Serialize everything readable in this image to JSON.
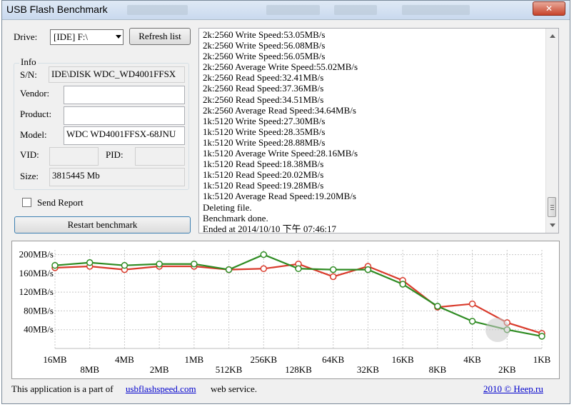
{
  "window": {
    "title": "USB Flash Benchmark",
    "close_glyph": "✕"
  },
  "drive": {
    "label": "Drive:",
    "selected": "[IDE] F:\\"
  },
  "refresh_label": "Refresh list",
  "info": {
    "group_label": "Info",
    "sn_label": "S/N:",
    "sn_value": "IDE\\DISK WDC_WD4001FFSX",
    "vendor_label": "Vendor:",
    "vendor_value": "",
    "product_label": "Product:",
    "product_value": "",
    "model_label": "Model:",
    "model_value": "WDC WD4001FFSX-68JNU",
    "vid_label": "VID:",
    "vid_value": "",
    "pid_label": "PID:",
    "pid_value": "",
    "size_label": "Size:",
    "size_value": "3815445 Mb"
  },
  "send_report_label": "Send Report",
  "restart_label": "Restart benchmark",
  "log_lines": [
    "2k:2560 Write Speed:53.05MB/s",
    "2k:2560 Write Speed:56.08MB/s",
    "2k:2560 Write Speed:56.05MB/s",
    "2k:2560 Average Write Speed:55.02MB/s",
    "2k:2560 Read Speed:32.41MB/s",
    "2k:2560 Read Speed:37.36MB/s",
    "2k:2560 Read Speed:34.51MB/s",
    "2k:2560 Average Read Speed:34.64MB/s",
    "1k:5120 Write Speed:27.30MB/s",
    "1k:5120 Write Speed:28.35MB/s",
    "1k:5120 Write Speed:28.88MB/s",
    "1k:5120 Average Write Speed:28.16MB/s",
    "1k:5120 Read Speed:18.38MB/s",
    "1k:5120 Read Speed:20.02MB/s",
    "1k:5120 Read Speed:19.28MB/s",
    "1k:5120 Average Read Speed:19.20MB/s",
    "Deleting file.",
    "Benchmark done.",
    "Ended at 2014/10/10 下午 07:46:17"
  ],
  "status": {
    "prefix": "This application is a part of",
    "link": "usbflashspeed.com",
    "suffix": "web service.",
    "credit": "2010 © Heep.ru"
  },
  "colors": {
    "write": "#d93a2b",
    "read": "#2e8b22"
  },
  "chart_data": {
    "type": "line",
    "x": [
      "16MB",
      "8MB",
      "4MB",
      "2MB",
      "1MB",
      "512KB",
      "256KB",
      "128KB",
      "64KB",
      "32KB",
      "16KB",
      "8KB",
      "4KB",
      "2KB",
      "1KB"
    ],
    "y_ticks": [
      "200MB/s",
      "160MB/s",
      "120MB/s",
      "80MB/s",
      "40MB/s"
    ],
    "y_tick_values": [
      200,
      160,
      120,
      80,
      40
    ],
    "ylim": [
      0,
      210
    ],
    "series": [
      {
        "values": [
          172,
          175,
          168,
          175,
          175,
          168,
          170,
          180,
          153,
          175,
          145,
          88,
          95,
          55,
          32
        ]
      },
      {
        "values": [
          177,
          183,
          177,
          180,
          180,
          168,
          200,
          170,
          168,
          168,
          137,
          90,
          58,
          40,
          26
        ]
      }
    ]
  }
}
